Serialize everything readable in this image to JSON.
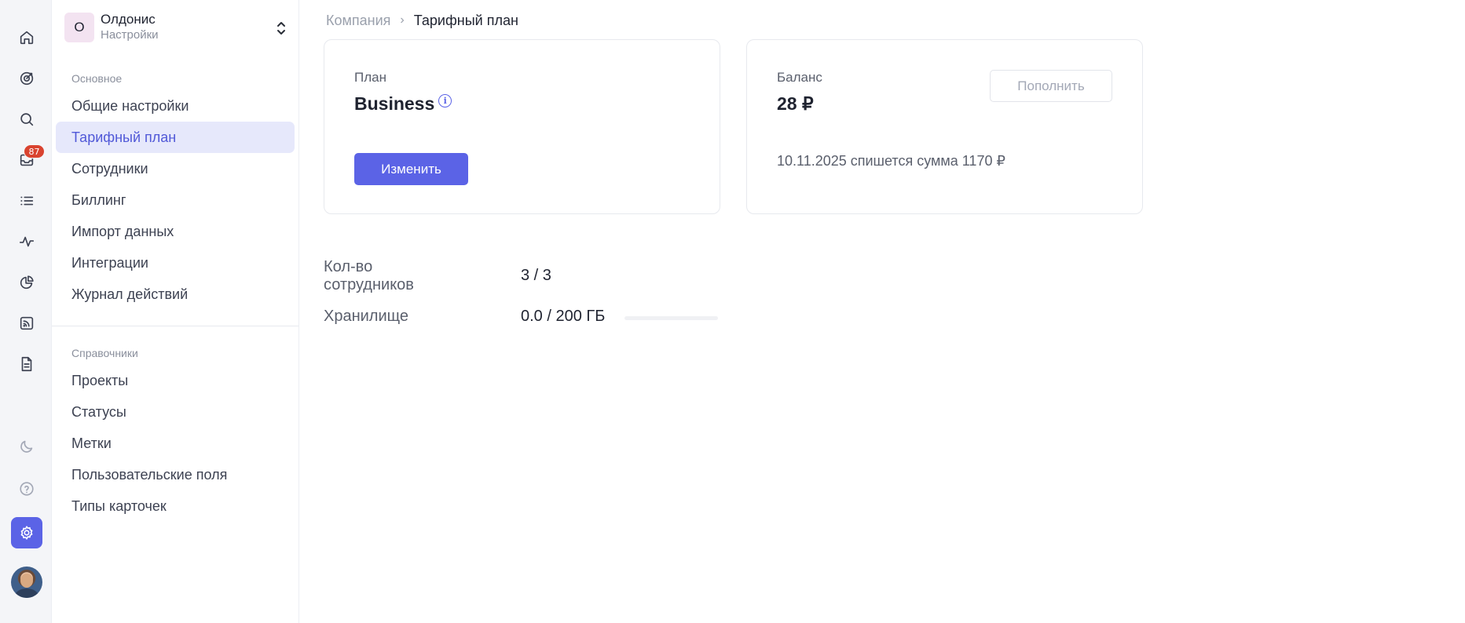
{
  "rail": {
    "inbox_badge": "87",
    "icons": [
      "home-icon",
      "target-icon",
      "search-icon",
      "inbox-icon",
      "list-icon",
      "activity-icon",
      "pie-chart-icon",
      "feed-icon",
      "document-icon",
      "moon-icon",
      "help-icon",
      "settings-icon",
      "avatar"
    ]
  },
  "org": {
    "letter": "О",
    "name": "Олдонис",
    "subtitle": "Настройки"
  },
  "sidebar": {
    "main_title": "Основное",
    "main_items": [
      {
        "label": "Общие настройки",
        "active": false
      },
      {
        "label": "Тарифный план",
        "active": true
      },
      {
        "label": "Сотрудники",
        "active": false
      },
      {
        "label": "Биллинг",
        "active": false
      },
      {
        "label": "Импорт данных",
        "active": false
      },
      {
        "label": "Интеграции",
        "active": false
      },
      {
        "label": "Журнал действий",
        "active": false
      }
    ],
    "ref_title": "Справочники",
    "ref_items": [
      {
        "label": "Проекты"
      },
      {
        "label": "Статусы"
      },
      {
        "label": "Метки"
      },
      {
        "label": "Пользовательские поля"
      },
      {
        "label": "Типы карточек"
      }
    ]
  },
  "breadcrumb": {
    "parent": "Компания",
    "current": "Тарифный план"
  },
  "plan_card": {
    "label": "План",
    "value": "Business",
    "button": "Изменить"
  },
  "balance_card": {
    "label": "Баланс",
    "value": "28 ₽",
    "button": "Пополнить",
    "note": "10.11.2025 спишется сумма 1170 ₽"
  },
  "stats": {
    "employees_label": "Кол-во сотрудников",
    "employees_value": "3 / 3",
    "storage_label": "Хранилище",
    "storage_value": "0.0 / 200 ГБ",
    "storage_fraction": 0.0
  },
  "colors": {
    "accent": "#5b63e6",
    "active_bg": "#e6e8fb",
    "badge": "#d9432f"
  }
}
